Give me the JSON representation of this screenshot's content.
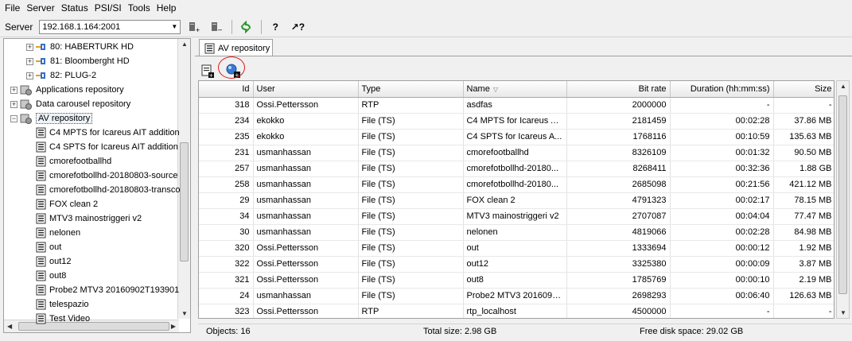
{
  "menu": [
    "File",
    "Server",
    "Status",
    "PSI/SI",
    "Tools",
    "Help"
  ],
  "toolbar": {
    "server_label": "Server",
    "server_value": "192.168.1.164:2001"
  },
  "tree": {
    "items": [
      {
        "label": "80: HABERTURK HD",
        "level": "service"
      },
      {
        "label": "81: Bloomberght HD",
        "level": "service"
      },
      {
        "label": "82: PLUG-2",
        "level": "service"
      },
      {
        "label": "Applications repository",
        "level": "root"
      },
      {
        "label": "Data carousel repository",
        "level": "root"
      },
      {
        "label": "AV repository",
        "level": "root",
        "selected": true
      },
      {
        "label": "C4 MPTS for Icareus AIT addition",
        "level": "file"
      },
      {
        "label": "C4 SPTS for Icareus AIT addition",
        "level": "file"
      },
      {
        "label": "cmorefootballhd",
        "level": "file"
      },
      {
        "label": "cmorefotbollhd-20180803-source",
        "level": "file"
      },
      {
        "label": "cmorefotbollhd-20180803-transco",
        "level": "file"
      },
      {
        "label": "FOX clean 2",
        "level": "file"
      },
      {
        "label": "MTV3 mainostriggeri v2",
        "level": "file"
      },
      {
        "label": "nelonen",
        "level": "file"
      },
      {
        "label": "out",
        "level": "file"
      },
      {
        "label": "out12",
        "level": "file"
      },
      {
        "label": "out8",
        "level": "file"
      },
      {
        "label": "Probe2 MTV3 20160902T193901",
        "level": "file"
      },
      {
        "label": "telespazio",
        "level": "file"
      },
      {
        "label": "Test Video",
        "level": "file"
      }
    ]
  },
  "tab": {
    "label": "AV repository"
  },
  "table": {
    "columns": [
      "Id",
      "User",
      "Type",
      "Name",
      "Bit rate",
      "Duration (hh:mm:ss)",
      "Size"
    ],
    "rows": [
      [
        "318",
        "Ossi.Pettersson",
        "RTP",
        "asdfas",
        "2000000",
        "-",
        "-"
      ],
      [
        "234",
        "ekokko",
        "File (TS)",
        "C4 MPTS for Icareus A...",
        "2181459",
        "00:02:28",
        "37.86 MB"
      ],
      [
        "235",
        "ekokko",
        "File (TS)",
        "C4 SPTS for Icareus A...",
        "1768116",
        "00:10:59",
        "135.63 MB"
      ],
      [
        "231",
        "usmanhassan",
        "File (TS)",
        "cmorefootballhd",
        "8326109",
        "00:01:32",
        "90.50 MB"
      ],
      [
        "257",
        "usmanhassan",
        "File (TS)",
        "cmorefotbollhd-20180...",
        "8268411",
        "00:32:36",
        "1.88 GB"
      ],
      [
        "258",
        "usmanhassan",
        "File (TS)",
        "cmorefotbollhd-20180...",
        "2685098",
        "00:21:56",
        "421.12 MB"
      ],
      [
        "29",
        "usmanhassan",
        "File (TS)",
        "FOX clean 2",
        "4791323",
        "00:02:17",
        "78.15 MB"
      ],
      [
        "34",
        "usmanhassan",
        "File (TS)",
        "MTV3 mainostriggeri v2",
        "2707087",
        "00:04:04",
        "77.47 MB"
      ],
      [
        "30",
        "usmanhassan",
        "File (TS)",
        "nelonen",
        "4819066",
        "00:02:28",
        "84.98 MB"
      ],
      [
        "320",
        "Ossi.Pettersson",
        "File (TS)",
        "out",
        "1333694",
        "00:00:12",
        "1.92 MB"
      ],
      [
        "322",
        "Ossi.Pettersson",
        "File (TS)",
        "out12",
        "3325380",
        "00:00:09",
        "3.87 MB"
      ],
      [
        "321",
        "Ossi.Pettersson",
        "File (TS)",
        "out8",
        "1785769",
        "00:00:10",
        "2.19 MB"
      ],
      [
        "24",
        "usmanhassan",
        "File (TS)",
        "Probe2 MTV3 2016090...",
        "2698293",
        "00:06:40",
        "126.63 MB"
      ],
      [
        "323",
        "Ossi.Pettersson",
        "RTP",
        "rtp_localhost",
        "4500000",
        "-",
        "-"
      ]
    ]
  },
  "status": {
    "objects": "Objects: 16",
    "total_size": "Total size: 2.98 GB",
    "free_disk": "Free disk space: 29.02 GB"
  },
  "colors": {
    "annotation_circle": "#e01818",
    "selection": "#eef3fa"
  }
}
